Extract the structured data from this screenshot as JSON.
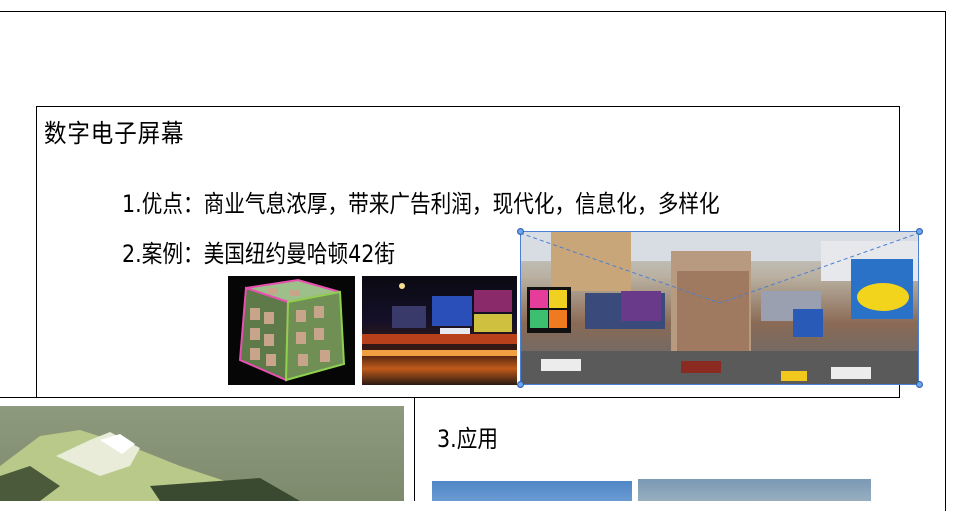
{
  "slide": {
    "title": "数字电子屏幕",
    "points": [
      "1.优点：商业气息浓厚，带来广告利润，现代化，信息化，多样化",
      "2.案例：美国纽约曼哈顿42街",
      "3.应用"
    ]
  },
  "images": {
    "cube": "led-cube-display",
    "street": "night-street-billboards",
    "panorama": "times-square-42nd-street-panorama",
    "model": "green-roof-building-model",
    "app1": "blue-sky-photo",
    "app2": "overcast-sky-photo"
  },
  "colors": {
    "selection": "#4a7fd4",
    "handle": "#6aa3ee"
  }
}
